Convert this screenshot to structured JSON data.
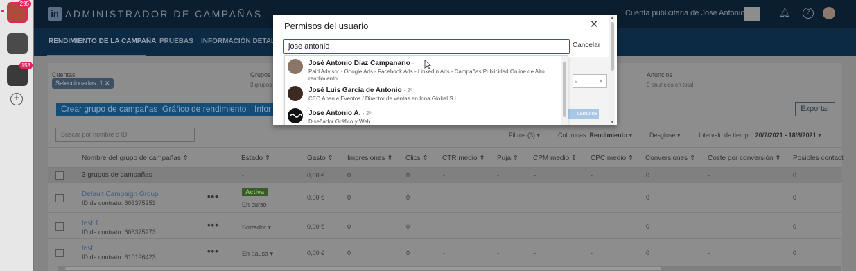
{
  "rail": {
    "apps": [
      {
        "badge": "295"
      },
      {
        "badge": ""
      },
      {
        "badge": "153"
      }
    ]
  },
  "header": {
    "logo_text": "in",
    "brand": "ADMINISTRADOR DE CAMPAÑAS",
    "account": "Cuenta publicitaria de José Antonio"
  },
  "subnav": {
    "tabs": [
      "RENDIMIENTO DE LA CAMPAÑA",
      "PRUEBAS",
      "INFORMACIÓN DETALLA"
    ]
  },
  "crumbs": {
    "cuentas_title": "Cuentas",
    "cuentas_chip": "Seleccionados: 1 ✕",
    "grupos_title": "Grupos",
    "grupos_sub": "3 grupos",
    "anuncios_title": "Anuncios",
    "anuncios_sub": "0 anuncios en total"
  },
  "toolbar": {
    "create_group": "Crear grupo de campañas",
    "perf_chart": "Gráfico de rendimiento",
    "info": "Infor",
    "export": "Exportar",
    "search_placeholder": "Buscar por nombre o ID"
  },
  "filters": {
    "filtros": "Filtros (3)",
    "columnas_label": "Columnas:",
    "columnas_value": "Rendimiento",
    "desglose": "Desglose",
    "intervalo_label": "Intervalo de tiempo:",
    "intervalo_value": "20/7/2021 - 18/8/2021"
  },
  "table": {
    "headers": [
      "Nombre del grupo de campañas",
      "Estado",
      "Gasto",
      "Impresiones",
      "Clics",
      "CTR medio",
      "Puja",
      "CPM medio",
      "CPC medio",
      "Conversiones",
      "Coste por conversión",
      "Posibles contact"
    ],
    "total": {
      "name": "3 grupos de campañas",
      "estado": "-",
      "gasto": "0,00 €",
      "impresiones": "0",
      "clics": "0",
      "ctr": "-",
      "puja": "-",
      "cpm": "-",
      "cpc": "-",
      "conversiones": "0",
      "coste": "-",
      "posibles": "0"
    },
    "rows": [
      {
        "name": "Default Campaign Group",
        "id": "ID de contrato: 603375253",
        "badge": "Activa",
        "estado": "En curso",
        "gasto": "0,00 €",
        "impresiones": "0",
        "clics": "0",
        "ctr": "-",
        "puja": "-",
        "cpm": "-",
        "cpc": "-",
        "conversiones": "0",
        "coste": "-",
        "posibles": "0"
      },
      {
        "name": "test 1",
        "id": "ID de contrato: 603375273",
        "badge": "",
        "estado": "Borrador ▾",
        "gasto": "0,00 €",
        "impresiones": "0",
        "clics": "0",
        "ctr": "-",
        "puja": "-",
        "cpm": "-",
        "cpc": "-",
        "conversiones": "0",
        "coste": "-",
        "posibles": "0"
      },
      {
        "name": "test",
        "id": "ID de contrato: 610196423",
        "badge": "",
        "estado": "En pausa ▾",
        "gasto": "0,00 €",
        "impresiones": "0",
        "clics": "0",
        "ctr": "-",
        "puja": "-",
        "cpm": "-",
        "cpc": "-",
        "conversiones": "0",
        "coste": "-",
        "posibles": "0"
      }
    ]
  },
  "modal": {
    "title": "Permisos del usuario",
    "close_icon": "close-icon",
    "search_value": "jose antonio",
    "cancel": "Cancelar",
    "under_select": "s",
    "under_button": "cambios",
    "results": [
      {
        "name": "José Antonio Díaz Campanario",
        "degree": "·",
        "desc": "Paid Advisor - Google Ads - Facebook Ads - LinkedIn Ads - Campañas Publicidad Online de Alto rendimiento",
        "avatar_color": "#8a7566"
      },
      {
        "name": "José Luis García de Antonio",
        "degree": "· 2º",
        "desc": "CEO Abania Eventos / Director de ventas en Inna Global S.L",
        "avatar_color": "#3a2a22"
      },
      {
        "name": "Jose Antonio A.",
        "degree": "· 2º",
        "desc": "Diseñador Gráfico y Web",
        "avatar_color": "#111111"
      }
    ]
  },
  "colors": {
    "linkedin_blue": "#0a66c2",
    "active_green": "#8fbf6a",
    "badge_red": "#e0245e"
  }
}
